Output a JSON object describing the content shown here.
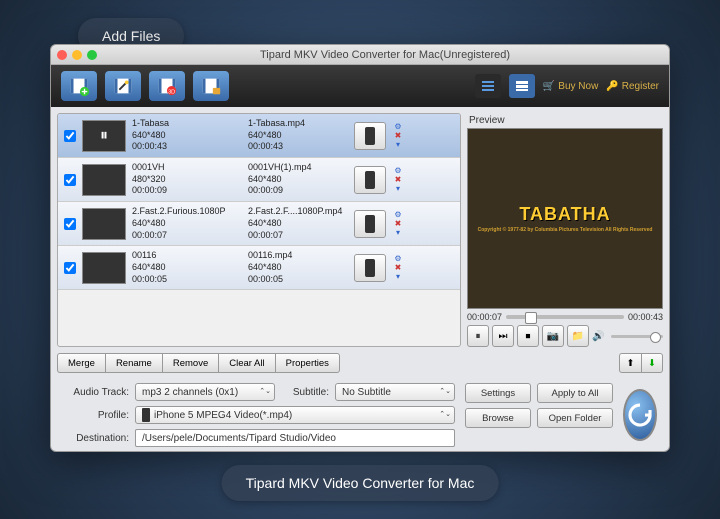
{
  "bubbles": {
    "top": "Add Files",
    "bottom": "Tipard MKV Video Converter for Mac"
  },
  "window": {
    "title": "Tipard MKV Video Converter for Mac(Unregistered)"
  },
  "toolbar": {
    "icons": [
      "add-file",
      "edit",
      "effect",
      "clip"
    ],
    "buy": "Buy Now",
    "register": "Register"
  },
  "preview": {
    "label": "Preview",
    "title": "TABATHA",
    "subtitle": "Copyright © 1977-82 by Columbia Pictures Television\nAll Rights Reserved",
    "cur": "00:00:07",
    "dur": "00:00:43"
  },
  "files": [
    {
      "name": "1-Tabasa",
      "res": "640*480",
      "dur": "00:00:43",
      "out": "1-Tabasa.mp4",
      "ores": "640*480",
      "odur": "00:00:43",
      "sel": true
    },
    {
      "name": "0001VH",
      "res": "480*320",
      "dur": "00:00:09",
      "out": "0001VH(1).mp4",
      "ores": "640*480",
      "odur": "00:00:09",
      "sel": false
    },
    {
      "name": "2.Fast.2.Furious.1080P",
      "res": "640*480",
      "dur": "00:00:07",
      "out": "2.Fast.2.F....1080P.mp4",
      "ores": "640*480",
      "odur": "00:00:07",
      "sel": false
    },
    {
      "name": "00116",
      "res": "640*480",
      "dur": "00:00:05",
      "out": "00116.mp4",
      "ores": "640*480",
      "odur": "00:00:05",
      "sel": false
    }
  ],
  "actions": {
    "merge": "Merge",
    "rename": "Rename",
    "remove": "Remove",
    "clear": "Clear All",
    "props": "Properties"
  },
  "settings": {
    "audio_label": "Audio Track:",
    "audio_val": "mp3 2 channels (0x1)",
    "sub_label": "Subtitle:",
    "sub_val": "No Subtitle",
    "profile_label": "Profile:",
    "profile_val": "iPhone 5 MPEG4 Video(*.mp4)",
    "dest_label": "Destination:",
    "dest_val": "/Users/pele/Documents/Tipard Studio/Video",
    "settings_btn": "Settings",
    "apply_btn": "Apply to All",
    "browse_btn": "Browse",
    "open_btn": "Open Folder"
  }
}
